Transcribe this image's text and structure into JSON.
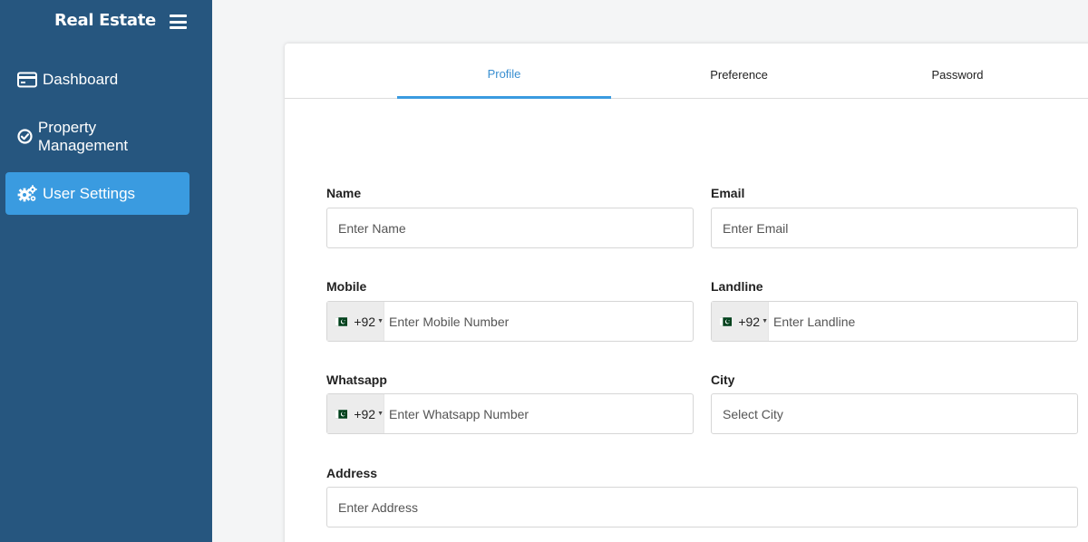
{
  "app": {
    "brand": "Real Estate"
  },
  "sidebar": {
    "items": [
      {
        "label": "Dashboard",
        "icon": "credit-card-icon"
      },
      {
        "label": "Property Management",
        "icon": "check-circle-icon"
      },
      {
        "label": "User Settings",
        "icon": "gears-icon",
        "active": true
      }
    ]
  },
  "tabs": [
    {
      "label": "Profile",
      "active": true
    },
    {
      "label": "Preference"
    },
    {
      "label": "Password"
    }
  ],
  "form": {
    "name": {
      "label": "Name",
      "placeholder": "Enter Name"
    },
    "email": {
      "label": "Email",
      "placeholder": "Enter Email"
    },
    "mobile": {
      "label": "Mobile",
      "code": "+92",
      "placeholder": "Enter Mobile Number"
    },
    "landline": {
      "label": "Landline",
      "code": "+92",
      "placeholder": "Enter Landline"
    },
    "whatsapp": {
      "label": "Whatsapp",
      "code": "+92",
      "placeholder": "Enter Whatsapp Number"
    },
    "city": {
      "label": "City",
      "placeholder": "Select City"
    },
    "address": {
      "label": "Address",
      "placeholder": "Enter Address"
    }
  },
  "colors": {
    "sidebar": "#26567f",
    "accent": "#3a9be0",
    "flag_green": "#01411c"
  }
}
